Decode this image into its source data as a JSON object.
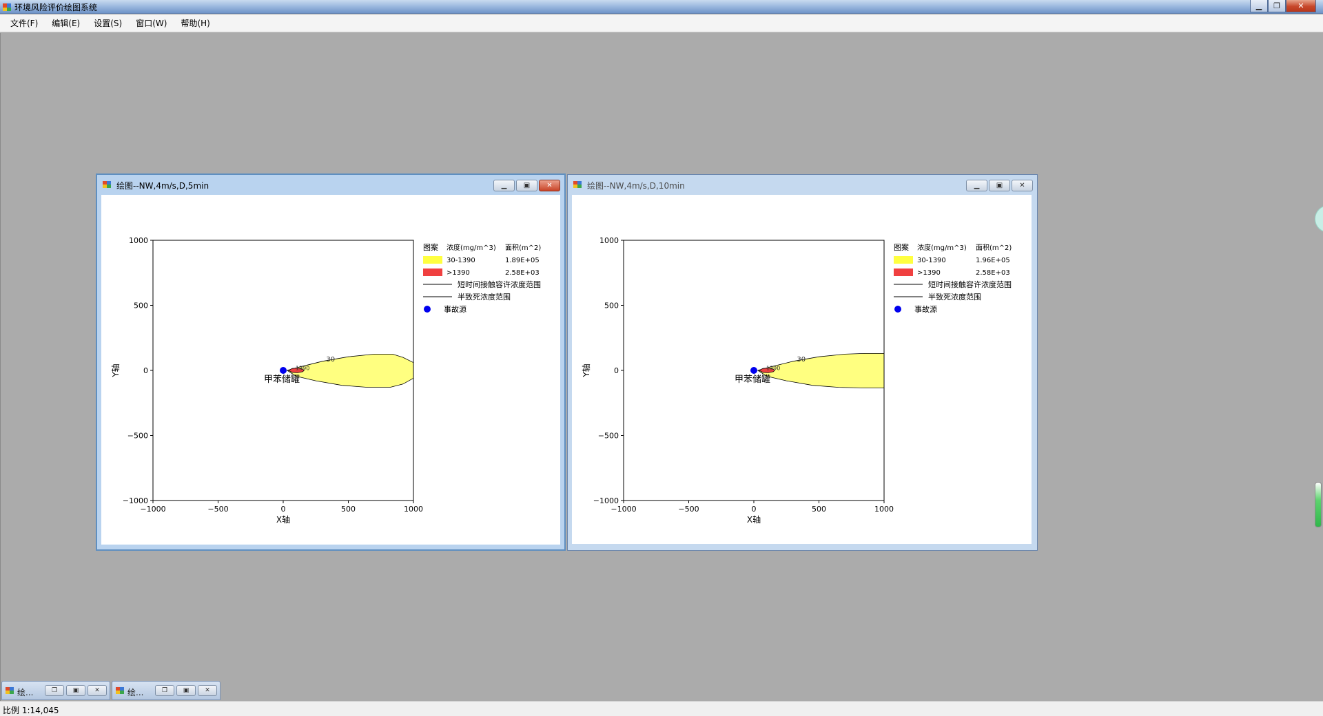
{
  "app": {
    "title": "环境风险评价绘图系统",
    "colors": {
      "titlebar": "#7da2d2",
      "mdi_background": "#ababab",
      "close": "#c7482a"
    }
  },
  "menu": [
    {
      "label": "文件(F)"
    },
    {
      "label": "编辑(E)"
    },
    {
      "label": "设置(S)"
    },
    {
      "label": "窗口(W)"
    },
    {
      "label": "帮助(H)"
    }
  ],
  "windows": [
    {
      "title": "绘图--NW,4m/s,D,5min",
      "active": true,
      "chart_data": {
        "type": "area",
        "xlabel": "X轴",
        "ylabel": "Y轴",
        "xlim": [
          -1000,
          1000
        ],
        "ylim": [
          -1000,
          1000
        ],
        "xticks": [
          "−1000",
          "−500",
          "0",
          "500",
          "1000"
        ],
        "yticks": [
          "1000",
          "500",
          "0",
          "−500",
          "−1000"
        ],
        "source": {
          "x": 0,
          "y": 0,
          "label": "甲苯储罐"
        },
        "contour_labels": [
          "30",
          "1390"
        ],
        "zones": [
          {
            "name": "30-1390",
            "color": "#ffff80",
            "area": "1.89E+05",
            "outline": [
              [
                30,
                0
              ],
              [
                120,
                25
              ],
              [
                300,
                70
              ],
              [
                500,
                105
              ],
              [
                700,
                125
              ],
              [
                840,
                125
              ],
              [
                920,
                100
              ],
              [
                1000,
                60
              ],
              [
                1000,
                -60
              ],
              [
                920,
                -105
              ],
              [
                820,
                -130
              ],
              [
                650,
                -130
              ],
              [
                450,
                -115
              ],
              [
                250,
                -80
              ],
              [
                100,
                -45
              ],
              [
                30,
                0
              ]
            ]
          },
          {
            "name": ">1390",
            "color": "#f04040",
            "area": "2.58E+03",
            "outline": [
              [
                40,
                0
              ],
              [
                70,
                15
              ],
              [
                110,
                18
              ],
              [
                150,
                10
              ],
              [
                160,
                0
              ],
              [
                150,
                -10
              ],
              [
                110,
                -18
              ],
              [
                70,
                -15
              ],
              [
                40,
                0
              ]
            ]
          }
        ],
        "legend": {
          "header_pattern": "图案",
          "header_conc": "浓度(mg/m^3)",
          "header_area": "面积(m^2)",
          "rows": [
            {
              "label": "30-1390",
              "area": "1.89E+05",
              "color": "#ffff40"
            },
            {
              "label": ">1390",
              "area": "2.58E+03",
              "color": "#f04040"
            }
          ],
          "line1": "短时间接触容许浓度范围",
          "line2": "半致死浓度范围",
          "source_label": "事故源"
        }
      }
    },
    {
      "title": "绘图--NW,4m/s,D,10min",
      "active": false,
      "chart_data": {
        "type": "area",
        "xlabel": "X轴",
        "ylabel": "Y轴",
        "xlim": [
          -1000,
          1000
        ],
        "ylim": [
          -1000,
          1000
        ],
        "xticks": [
          "−1000",
          "−500",
          "0",
          "500",
          "1000"
        ],
        "yticks": [
          "1000",
          "500",
          "0",
          "−500",
          "−1000"
        ],
        "source": {
          "x": 0,
          "y": 0,
          "label": "甲苯储罐"
        },
        "contour_labels": [
          "30",
          "1390"
        ],
        "zones": [
          {
            "name": "30-1390",
            "color": "#ffff80",
            "area": "1.96E+05",
            "outline": [
              [
                30,
                0
              ],
              [
                120,
                25
              ],
              [
                300,
                70
              ],
              [
                500,
                105
              ],
              [
                700,
                125
              ],
              [
                850,
                130
              ],
              [
                1000,
                130
              ],
              [
                1000,
                -135
              ],
              [
                850,
                -135
              ],
              [
                650,
                -130
              ],
              [
                450,
                -115
              ],
              [
                250,
                -80
              ],
              [
                100,
                -45
              ],
              [
                30,
                0
              ]
            ]
          },
          {
            "name": ">1390",
            "color": "#f04040",
            "area": "2.58E+03",
            "outline": [
              [
                40,
                0
              ],
              [
                70,
                15
              ],
              [
                110,
                18
              ],
              [
                150,
                10
              ],
              [
                160,
                0
              ],
              [
                150,
                -10
              ],
              [
                110,
                -18
              ],
              [
                70,
                -15
              ],
              [
                40,
                0
              ]
            ]
          }
        ],
        "legend": {
          "header_pattern": "图案",
          "header_conc": "浓度(mg/m^3)",
          "header_area": "面积(m^2)",
          "rows": [
            {
              "label": "30-1390",
              "area": "1.96E+05",
              "color": "#ffff40"
            },
            {
              "label": ">1390",
              "area": "2.58E+03",
              "color": "#f04040"
            }
          ],
          "line1": "短时间接触容许浓度范围",
          "line2": "半致死浓度范围",
          "source_label": "事故源"
        }
      }
    }
  ],
  "minimized": [
    {
      "title": "绘..."
    },
    {
      "title": "绘..."
    }
  ],
  "status": {
    "scale": "比例 1:14,045"
  }
}
